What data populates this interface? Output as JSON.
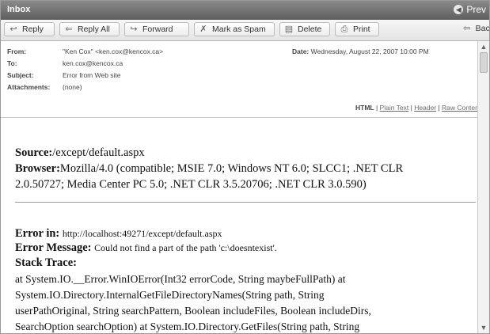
{
  "titlebar": {
    "title": "Inbox",
    "prev_label": "Prev"
  },
  "toolbar": {
    "reply": "Reply",
    "reply_all": "Reply All",
    "forward": "Forward",
    "mark_spam": "Mark as Spam",
    "delete": "Delete",
    "print": "Print",
    "back": "Back"
  },
  "header": {
    "from_label": "From:",
    "from_value": "\"Ken Cox\" <ken.cox@kencox.ca>",
    "to_label": "To:",
    "to_value": "ken.cox@kencox.ca",
    "subject_label": "Subject:",
    "subject_value": "Error from Web site",
    "attachments_label": "Attachments:",
    "attachments_value": "(none)",
    "date_label": "Date:",
    "date_value": "Wednesday, August 22, 2007 10:00 PM",
    "view_html": "HTML",
    "view_plain": "Plain Text",
    "view_header": "Header",
    "view_raw": "Raw Content"
  },
  "message": {
    "source_label": "Source:",
    "source_value": "/except/default.aspx",
    "browser_label": "Browser:",
    "browser_value_1": "Mozilla/4.0 (compatible; MSIE 7.0; Windows NT 6.0; SLCC1; .NET CLR",
    "browser_value_2": "2.0.50727; Media Center PC 5.0; .NET CLR 3.5.20706; .NET CLR 3.0.590)",
    "error_in_label": "Error in:",
    "error_in_value": "http://localhost:49271/except/default.aspx",
    "error_msg_label": "Error Message:",
    "error_msg_value": "Could not find a part of the path 'c:\\doesntexist'.",
    "stack_label": "Stack Trace:",
    "stack_1": "at System.IO.__Error.WinIOError(Int32 errorCode, String maybeFullPath) at",
    "stack_2": "System.IO.Directory.InternalGetFileDirectoryNames(String path, String",
    "stack_3": "userPathOriginal, String searchPattern, Boolean includeFiles, Boolean includeDirs,",
    "stack_4": "SearchOption searchOption) at System.IO.Directory.GetFiles(String path, String"
  }
}
